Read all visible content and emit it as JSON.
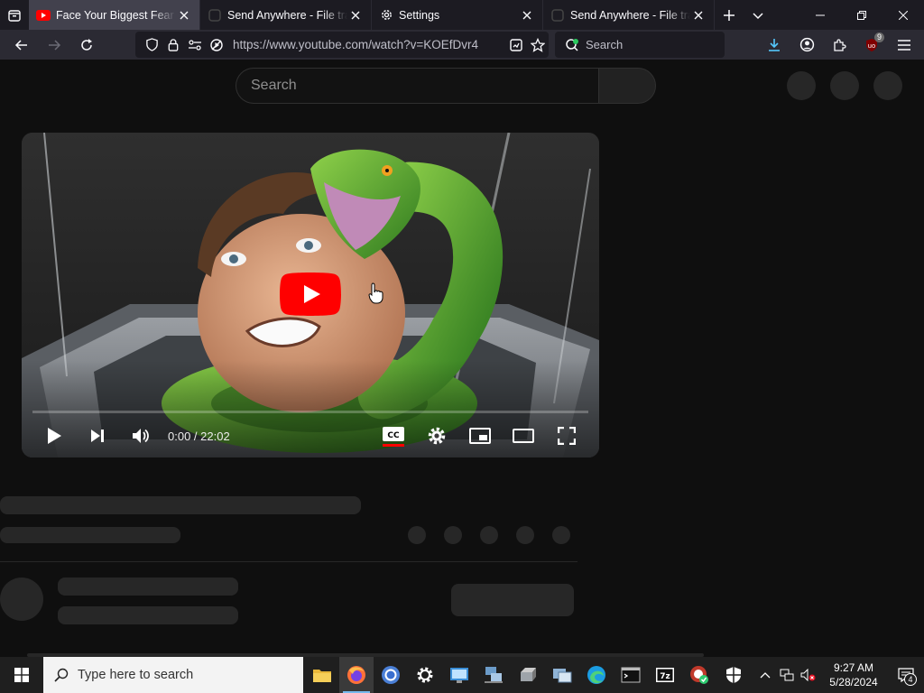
{
  "browser": {
    "tabs": [
      {
        "title": "Face Your Biggest Fear To",
        "favicon": "youtube-icon",
        "active": true
      },
      {
        "title": "Send Anywhere - File tran",
        "favicon": "send-anywhere-icon",
        "active": false
      },
      {
        "title": "Settings",
        "favicon": "gear-icon",
        "active": false
      },
      {
        "title": "Send Anywhere - File tran",
        "favicon": "send-anywhere-icon",
        "active": false
      }
    ],
    "url": "https://www.youtube.com/watch?v=KOEfDvr4",
    "search_placeholder": "Search",
    "extension_badge": "9"
  },
  "youtube": {
    "search_placeholder": "Search",
    "player": {
      "time": "0:00 / 22:02",
      "progress": 0
    }
  },
  "taskbar": {
    "search_placeholder": "Type here to search",
    "clock_time": "9:27 AM",
    "clock_date": "5/28/2024",
    "notification_count": "4"
  },
  "colors": {
    "youtube_red": "#ff0000",
    "accent_blue": "#76b9ed",
    "page_bg": "#0f0f0f"
  }
}
